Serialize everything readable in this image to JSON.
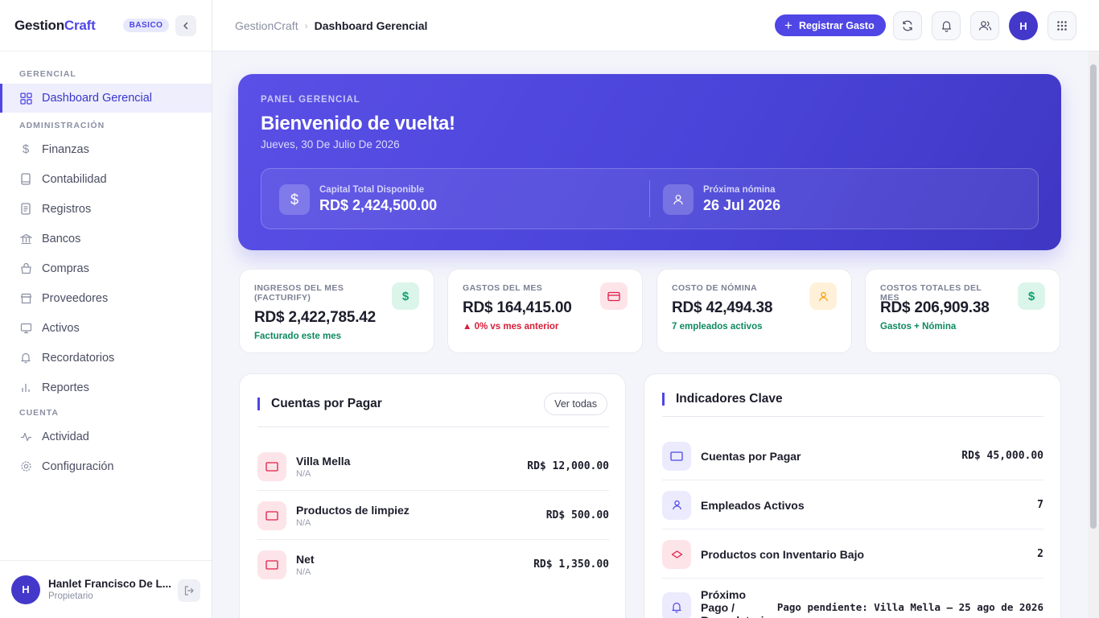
{
  "brand": {
    "name_prefix": "Gestion",
    "name_suffix": "Craft",
    "plan": "BASICO"
  },
  "sidebar": {
    "sections": [
      {
        "label": "GERENCIAL"
      },
      {
        "label": "ADMINISTRACIÓN"
      },
      {
        "label": "CUENTA"
      }
    ],
    "items": [
      {
        "label": "Dashboard Gerencial",
        "icon": "grid-icon",
        "active": true
      },
      {
        "label": "Finanzas",
        "icon": "dollar-icon"
      },
      {
        "label": "Contabilidad",
        "icon": "book-icon"
      },
      {
        "label": "Registros",
        "icon": "document-icon"
      },
      {
        "label": "Bancos",
        "icon": "bank-icon"
      },
      {
        "label": "Compras",
        "icon": "basket-icon"
      },
      {
        "label": "Proveedores",
        "icon": "store-icon"
      },
      {
        "label": "Activos",
        "icon": "monitor-icon"
      },
      {
        "label": "Recordatorios",
        "icon": "bell-icon"
      },
      {
        "label": "Reportes",
        "icon": "bar-chart-icon"
      },
      {
        "label": "Actividad",
        "icon": "activity-icon"
      },
      {
        "label": "Configuración",
        "icon": "gear-icon"
      }
    ],
    "user": {
      "initial": "H",
      "name": "Hanlet Francisco De L...",
      "role": "Propietario"
    }
  },
  "topbar": {
    "breadcrumb_root": "GestionCraft",
    "breadcrumb_sep": "›",
    "breadcrumb_current": "Dashboard Gerencial",
    "primary_button": "Registrar Gasto",
    "avatar_initial": "H"
  },
  "hero": {
    "eyebrow": "PANEL GERENCIAL",
    "title": "Bienvenido de vuelta!",
    "date": "Jueves, 30 De Julio De 2026",
    "stats": [
      {
        "label": "Capital Total Disponible",
        "value": "RD$ 2,424,500.00",
        "icon": "dollar-icon"
      },
      {
        "label": "Próxima nómina",
        "value": "26 Jul 2026",
        "icon": "user-icon"
      }
    ]
  },
  "kpis": [
    {
      "label": "INGRESOS DEL MES (FACTURIFY)",
      "value": "RD$ 2,422,785.42",
      "sub": "Facturado este mes",
      "sub_color": "#0e8a5f",
      "icon": "dollar-icon",
      "icon_bg": "#dcf5ea",
      "icon_color": "#10a36b"
    },
    {
      "label": "GASTOS DEL MES",
      "value": "RD$ 164,415.00",
      "sub": "▲ 0% vs mes anterior",
      "sub_color": "#d61f3a",
      "icon": "credit-card-icon",
      "icon_bg": "#fde4e8",
      "icon_color": "#e11d48"
    },
    {
      "label": "COSTO DE NÓMINA",
      "value": "RD$ 42,494.38",
      "sub": "7 empleados activos",
      "sub_color": "#0e8a5f",
      "icon": "user-icon",
      "icon_bg": "#fff1d9",
      "icon_color": "#f59e0b"
    },
    {
      "label": "COSTOS TOTALES DEL MES",
      "value": "RD$ 206,909.38",
      "sub": "Gastos + Nómina",
      "sub_color": "#0e8a5f",
      "icon": "dollar-icon",
      "icon_bg": "#dcf5ea",
      "icon_color": "#10a36b"
    }
  ],
  "payables": {
    "title": "Cuentas por Pagar",
    "view_all": "Ver todas",
    "rows": [
      {
        "name": "Villa Mella",
        "sub": "N/A",
        "amount": "RD$ 12,000.00"
      },
      {
        "name": "Productos de limpiez",
        "sub": "N/A",
        "amount": "RD$ 500.00"
      },
      {
        "name": "Net",
        "sub": "N/A",
        "amount": "RD$ 1,350.00"
      }
    ]
  },
  "indicators": {
    "title": "Indicadores Clave",
    "rows": [
      {
        "name": "Cuentas por Pagar",
        "value": "RD$ 45,000.00",
        "icon": "card-icon",
        "icon_bg": "#ecebfd",
        "icon_color": "#4f46e5"
      },
      {
        "name": "Empleados Activos",
        "value": "7",
        "icon": "user-icon",
        "icon_bg": "#ecebfd",
        "icon_color": "#4f46e5"
      },
      {
        "name": "Productos con Inventario Bajo",
        "value": "2",
        "icon": "tag-icon",
        "icon_bg": "#fde4e8",
        "icon_color": "#e11d48"
      },
      {
        "name": "Próximo Pago / Recordatorio",
        "value": "Pago pendiente: Villa Mella — 25 ago de 2026",
        "icon": "bell-icon",
        "icon_bg": "#ecebfd",
        "icon_color": "#4f46e5"
      }
    ]
  }
}
